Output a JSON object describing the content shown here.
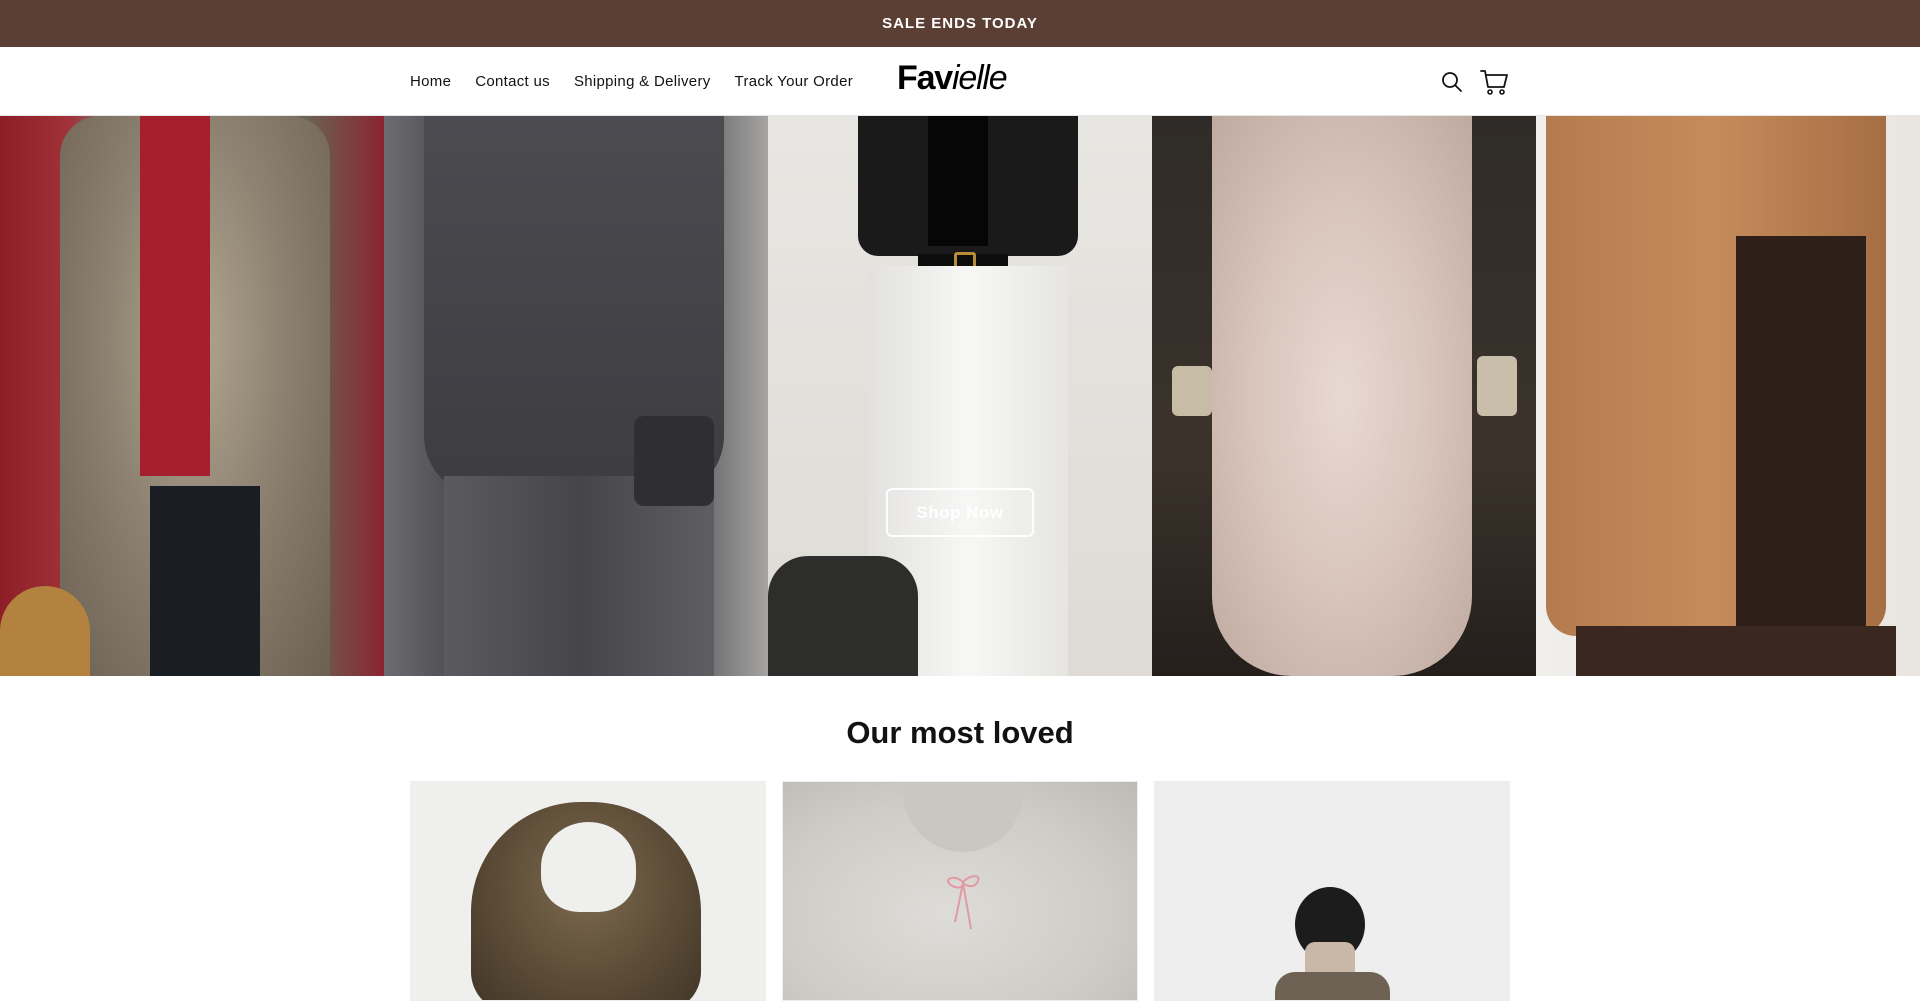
{
  "announcement": {
    "text": "SALE ENDS TODAY"
  },
  "header": {
    "nav": [
      {
        "label": "Home"
      },
      {
        "label": "Contact us"
      },
      {
        "label": "Shipping & Delivery"
      },
      {
        "label": "Track Your Order"
      }
    ],
    "logo": {
      "part1": "Fav",
      "part2": "ielle"
    },
    "icons": [
      "search-icon",
      "cart-icon"
    ]
  },
  "hero": {
    "cta_label": "Shop Now"
  },
  "featured": {
    "title": "Our most loved"
  },
  "colors": {
    "announcement_bg": "#5b3f34",
    "text": "#121212",
    "background": "#ffffff"
  }
}
